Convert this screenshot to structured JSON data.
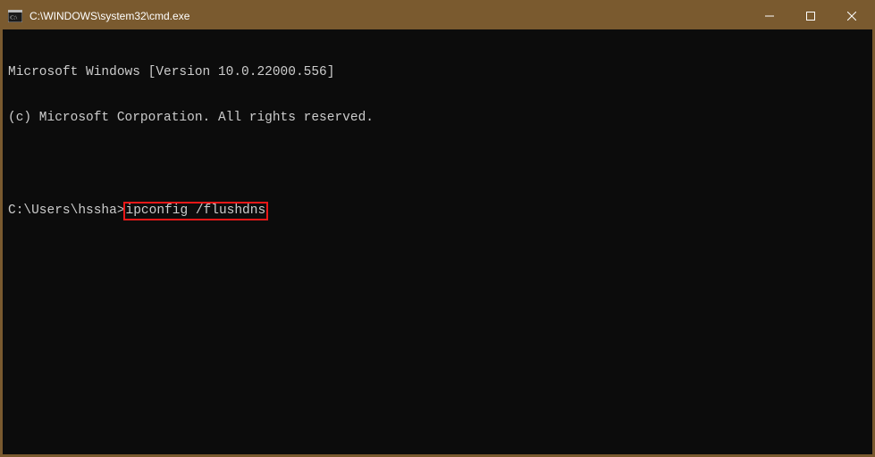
{
  "titlebar": {
    "title": "C:\\WINDOWS\\system32\\cmd.exe"
  },
  "terminal": {
    "line1": "Microsoft Windows [Version 10.0.22000.556]",
    "line2": "(c) Microsoft Corporation. All rights reserved.",
    "prompt": "C:\\Users\\hssha>",
    "highlighted_command": "ipconfig /flushdns"
  },
  "highlightColor": "#e91818"
}
